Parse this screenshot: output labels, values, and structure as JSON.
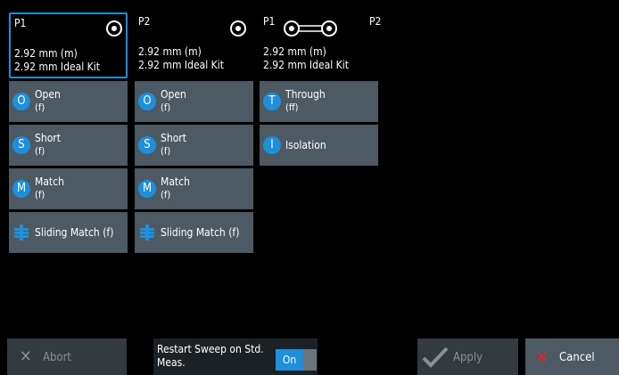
{
  "ports": [
    {
      "title": "P1",
      "connector": "2.92 mm (m)",
      "kit": "2.92 mm Ideal Kit",
      "selected": true
    },
    {
      "title": "P2",
      "connector": "2.92 mm (m)",
      "kit": "2.92 mm Ideal Kit",
      "selected": false
    },
    {
      "title_left": "P1",
      "title_right": "P2",
      "connector": "2.92 mm (m)",
      "kit": "2.92 mm Ideal Kit",
      "selected": false
    }
  ],
  "column1": [
    {
      "badge": "O",
      "name": "Open",
      "sub": "(f)"
    },
    {
      "badge": "S",
      "name": "Short",
      "sub": "(f)"
    },
    {
      "badge": "M",
      "name": "Match",
      "sub": "(f)"
    },
    {
      "name": "Sliding Match (f)"
    }
  ],
  "column2": [
    {
      "badge": "O",
      "name": "Open",
      "sub": "(f)"
    },
    {
      "badge": "S",
      "name": "Short",
      "sub": "(f)"
    },
    {
      "badge": "M",
      "name": "Match",
      "sub": "(f)"
    },
    {
      "name": "Sliding Match (f)"
    }
  ],
  "column3": [
    {
      "badge": "T",
      "name": "Through",
      "sub": "(ff)"
    },
    {
      "badge": "I",
      "name": "Isolation"
    }
  ],
  "bottom": {
    "abort": "Abort",
    "restart": "Restart Sweep on Std. Meas.",
    "toggle": "On",
    "apply": "Apply",
    "cancel": "Cancel"
  },
  "colors": {
    "accent": "#1e8fdb",
    "button": "#4d5963",
    "disabled": "#333a40",
    "cancel_icon": "#e8262a"
  }
}
